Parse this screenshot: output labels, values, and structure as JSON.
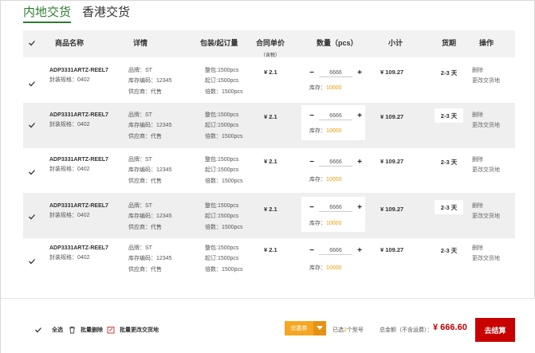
{
  "tabs": [
    {
      "label": "内地交货",
      "active": true
    },
    {
      "label": "香港交货",
      "active": false
    }
  ],
  "header": {
    "product_name": "商品名称",
    "details": "详情",
    "package": "包装/起订量",
    "contract_price": "合同单价",
    "tax_included": "（含税）",
    "quantity": "数量（pcs）",
    "subtotal": "小计",
    "delivery": "货期",
    "operation": "操作"
  },
  "rows": [
    {
      "model": "ADP3331ARTZ-REEL7",
      "spec": "封装规格：0402",
      "brand": "品牌：ST",
      "stock_code": "库存编码：12345",
      "supplier": "供应商：代售",
      "pack": "整包:1500pcs",
      "moq": "起订:1500pcs",
      "multiple": "倍数：1500pcs",
      "price": "¥ 2.1",
      "qty": "6666",
      "stock_label": "库存：",
      "stock_value": "10000",
      "subtotal": "¥ 109.27",
      "delivery": "2-3 天",
      "delete": "删除",
      "change_delivery": "更改交货地"
    },
    {
      "model": "ADP3331ARTZ-REEL7",
      "spec": "封装规格：0402",
      "brand": "品牌：ST",
      "stock_code": "库存编码：12345",
      "supplier": "供应商：代售",
      "pack": "整包:1500pcs",
      "moq": "起订:1500pcs",
      "multiple": "倍数：1500pcs",
      "price": "¥ 2.1",
      "qty": "6666",
      "stock_label": "库存：",
      "stock_value": "10000",
      "subtotal": "¥ 109.27",
      "delivery": "2-3 天",
      "delete": "删除",
      "change_delivery": "更改交货地"
    },
    {
      "model": "ADP3331ARTZ-REEL7",
      "spec": "封装规格：0402",
      "brand": "品牌：ST",
      "stock_code": "库存编码：12345",
      "supplier": "供应商：代售",
      "pack": "整包:1500pcs",
      "moq": "起订:1500pcs",
      "multiple": "倍数：1500pcs",
      "price": "¥ 2.1",
      "qty": "6666",
      "stock_label": "库存：",
      "stock_value": "10000",
      "subtotal": "¥ 109.27",
      "delivery": "2-3 天",
      "delete": "删除",
      "change_delivery": "更改交货地"
    },
    {
      "model": "ADP3331ARTZ-REEL7",
      "spec": "封装规格：0402",
      "brand": "品牌：ST",
      "stock_code": "库存编码：12345",
      "supplier": "供应商：代售",
      "pack": "整包:1500pcs",
      "moq": "起订:1500pcs",
      "multiple": "倍数：1500pcs",
      "price": "¥ 2.1",
      "qty": "6666",
      "stock_label": "库存：",
      "stock_value": "10000",
      "subtotal": "¥ 109.27",
      "delivery": "2-3 天",
      "delete": "删除",
      "change_delivery": "更改交货地"
    },
    {
      "model": "ADP3331ARTZ-REEL7",
      "spec": "封装规格：0402",
      "brand": "品牌：ST",
      "stock_code": "库存编码：12345",
      "supplier": "供应商：代售",
      "pack": "整包:1500pcs",
      "moq": "起订:1500pcs",
      "multiple": "倍数：1500pcs",
      "price": "¥ 2.1",
      "qty": "6666",
      "stock_label": "库存：",
      "stock_value": "10000",
      "subtotal": "¥ 109.27",
      "delivery": "2-3 天",
      "delete": "删除",
      "change_delivery": "更改交货地"
    }
  ],
  "footer": {
    "select_all": "全选",
    "batch_delete": "批量删除",
    "batch_change_delivery": "批量更改交货地",
    "coupon": "优惠券",
    "selected_prefix": "已选",
    "selected_count": "2",
    "selected_suffix": "个型号",
    "total_label": "总金额（不含运费）：",
    "total_value": "¥ 666.60",
    "checkout": "去结算"
  },
  "colors": {
    "active_tab": "#2e7d32",
    "stock": "#e89b00",
    "coupon": "#f5a623",
    "total": "#c00000",
    "checkout": "#c90000"
  }
}
